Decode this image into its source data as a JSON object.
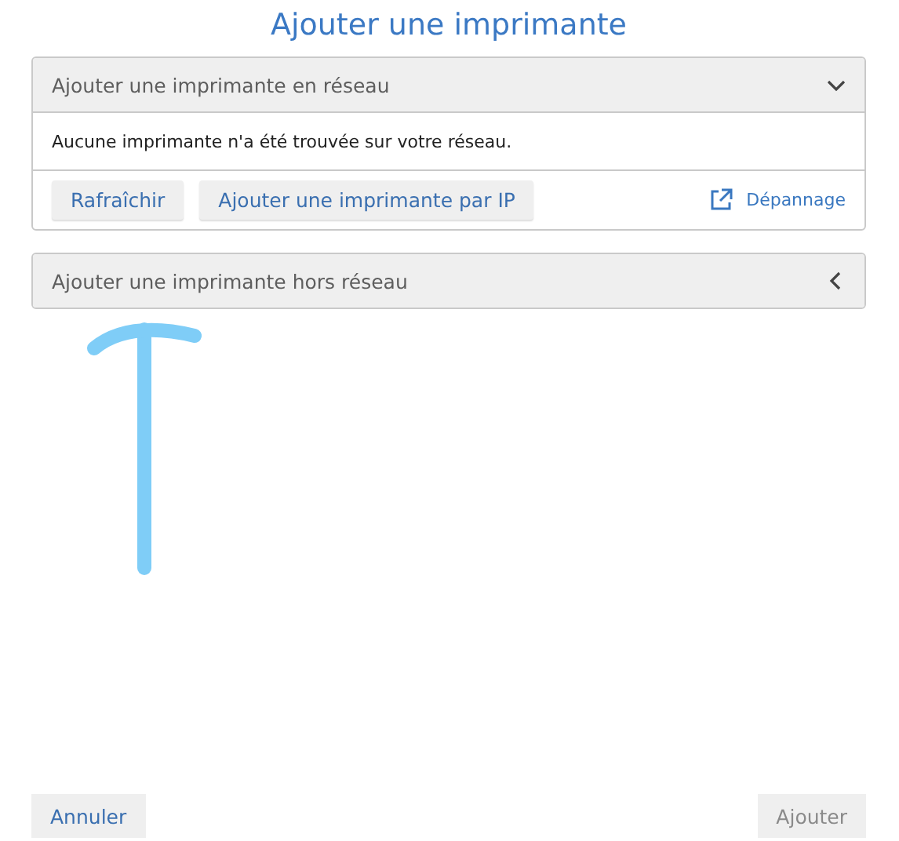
{
  "title": "Ajouter une imprimante",
  "sections": [
    {
      "title": "Ajouter une imprimante en réseau",
      "expanded": true,
      "message": "Aucune imprimante n'a été trouvée sur votre réseau.",
      "buttons": [
        "Rafraîchir",
        "Ajouter une imprimante par IP"
      ],
      "link": "Dépannage"
    },
    {
      "title": "Ajouter une imprimante hors réseau",
      "expanded": false
    }
  ],
  "annotation": {
    "kind": "arrow"
  },
  "footer": {
    "cancel": {
      "label": "Annuler",
      "disabled": false
    },
    "confirm": {
      "label": "Ajouter",
      "disabled": true
    }
  }
}
